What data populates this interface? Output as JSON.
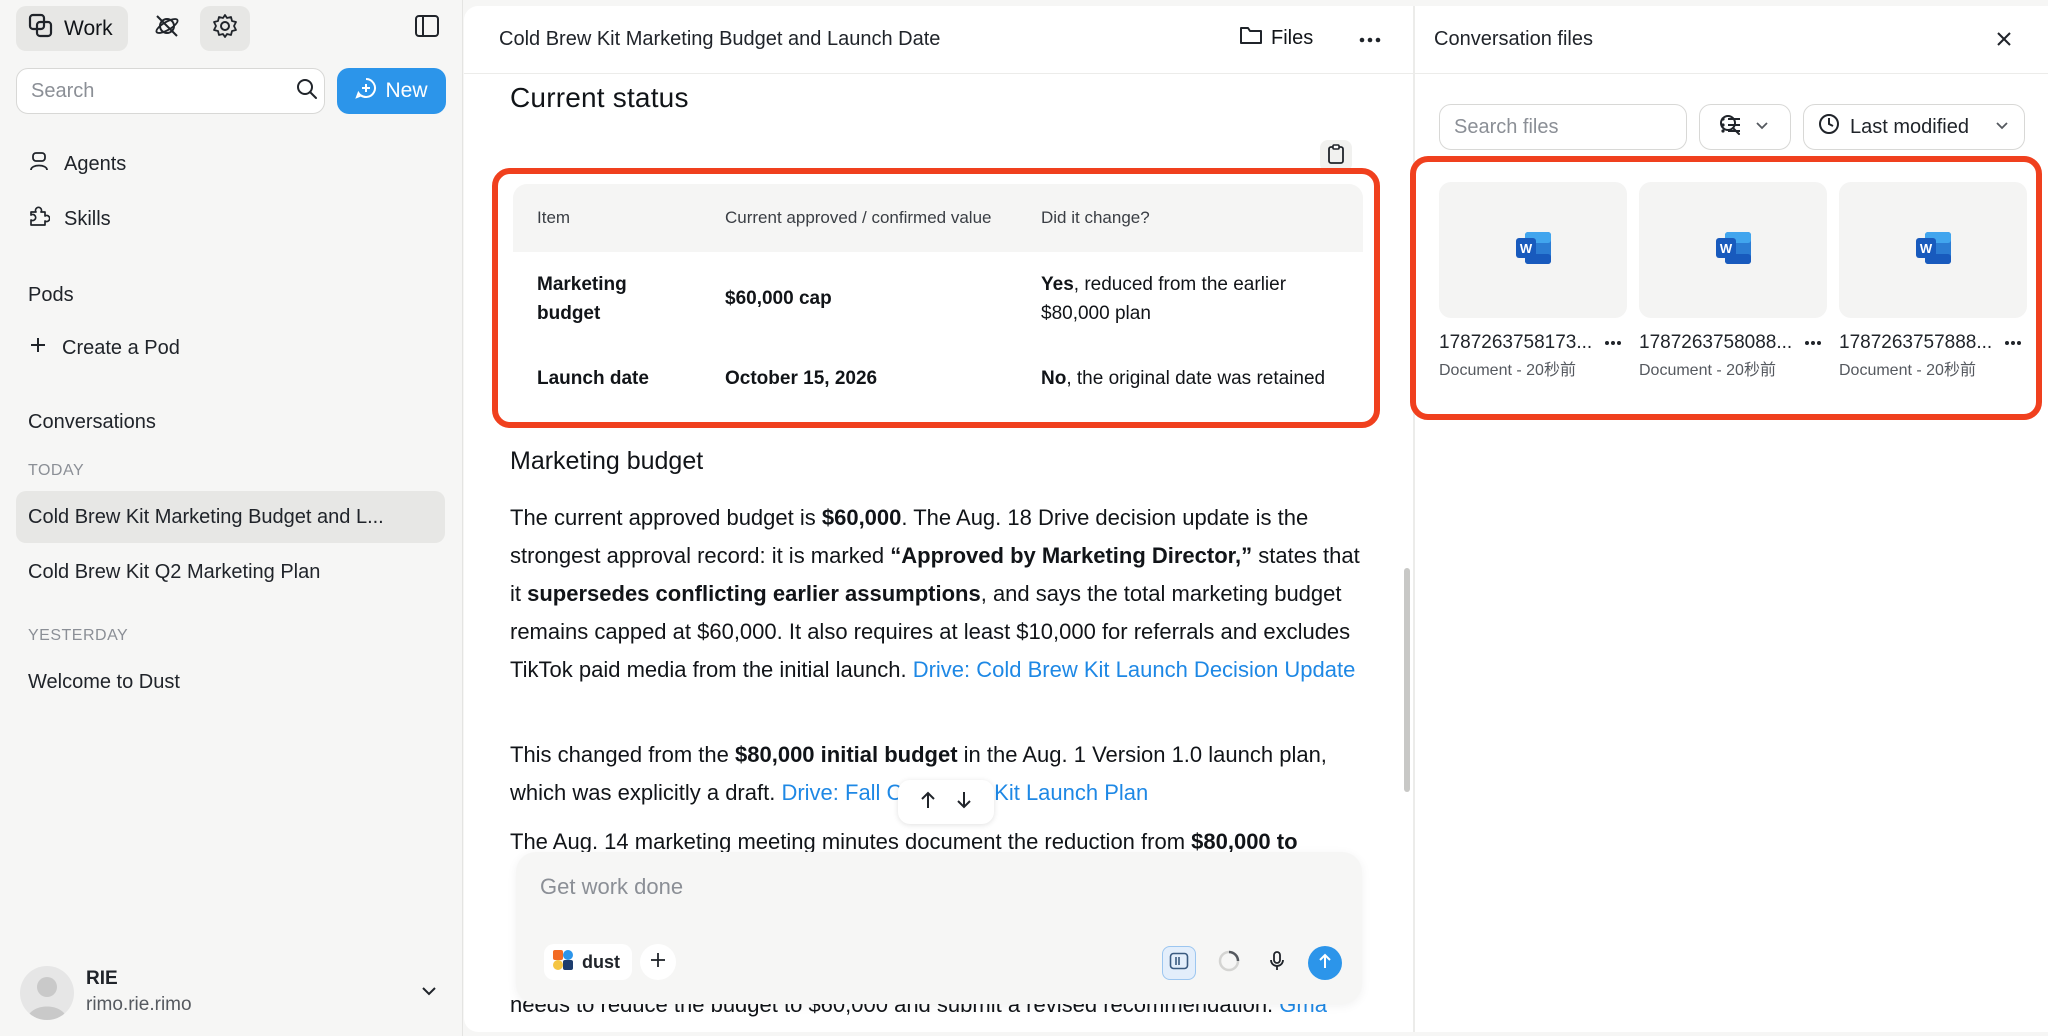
{
  "sidebar": {
    "work_label": "Work",
    "search_placeholder": "Search",
    "new_label": "New",
    "nav": [
      {
        "label": "Agents",
        "icon": "agents-icon"
      },
      {
        "label": "Skills",
        "icon": "puzzle-icon"
      }
    ],
    "pods_heading": "Pods",
    "create_pod_label": "Create a Pod",
    "conversations_heading": "Conversations",
    "groups": [
      {
        "date": "TODAY",
        "items": [
          "Cold Brew Kit Marketing Budget and L...",
          "Cold Brew Kit Q2 Marketing Plan"
        ]
      },
      {
        "date": "YESTERDAY",
        "items": [
          "Welcome to Dust"
        ]
      }
    ],
    "user": {
      "name": "RIE",
      "handle": "rimo.rie.rimo"
    }
  },
  "main": {
    "title": "Cold Brew Kit Marketing Budget and Launch Date",
    "files_label": "Files",
    "status_heading": "Current status",
    "table": {
      "headers": [
        "Item",
        "Current approved / confirmed value",
        "Did it change?"
      ],
      "rows": [
        {
          "item": "Marketing budget",
          "value": "$60,000 cap",
          "change_strong": "Yes",
          "change_rest": ", reduced from the earlier $80,000 plan"
        },
        {
          "item": "Launch date",
          "value": "October 15, 2026",
          "change_strong": "No",
          "change_rest": ", the original date was retained"
        }
      ]
    },
    "budget_heading": "Marketing budget",
    "p1": {
      "t1": "The current approved budget is ",
      "b1": "$60,000",
      "t2": ". The Aug. 18 Drive decision update is the strongest approval record: it is marked ",
      "b2": "“Approved by Marketing Director,”",
      "t3": " states that it ",
      "b3": "supersedes conflicting earlier assumptions",
      "t4": ", and says the total marketing budget remains capped at $60,000. It also requires at least $10,000 for referrals and excludes TikTok paid media from the initial launch. ",
      "link": "Drive: Cold Brew Kit Launch Decision Update"
    },
    "p2": {
      "t1": "This changed from the ",
      "b1": "$80,000 initial budget",
      "t2": " in the Aug. 1 Version 1.0 launch plan, which was explicitly a draft. ",
      "link": "Drive: Fall Cold Brew Kit Launch Plan"
    },
    "p3": {
      "t1": "The Aug. 14 marketing meeting minutes document the reduction from ",
      "b1": "$80,000 to"
    },
    "p4": {
      "t1": "needs to reduce the budget to $60,000 and submit a revised recommendation. ",
      "link": "Gma"
    },
    "composer_placeholder": "Get work done",
    "agent_label": "dust"
  },
  "files_panel": {
    "title": "Conversation files",
    "search_placeholder": "Search files",
    "sort_label": "Last modified",
    "files": [
      {
        "name": "1787263758173...",
        "meta": "Document - 20秒前"
      },
      {
        "name": "1787263758088...",
        "meta": "Document - 20秒前"
      },
      {
        "name": "1787263757888...",
        "meta": "Document - 20秒前"
      }
    ]
  },
  "colors": {
    "accent": "#2c95ea",
    "highlight": "#f0401e",
    "link": "#1e88e5"
  }
}
